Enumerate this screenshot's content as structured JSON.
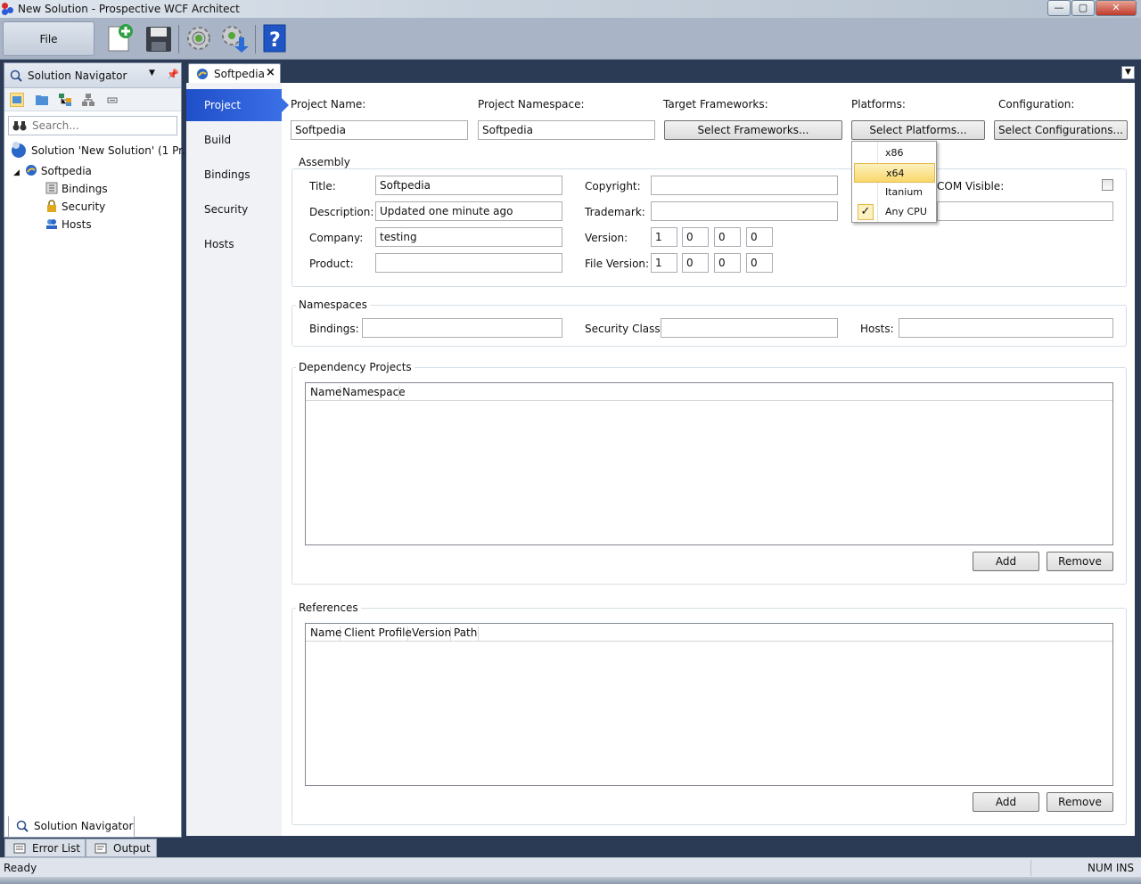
{
  "window": {
    "title": "New Solution - Prospective WCF Architect",
    "minimize": "—",
    "maximize": "▢",
    "close": "✕"
  },
  "toolbar": {
    "file_label": "File",
    "icons": [
      "new-document-icon",
      "save-icon",
      "gear-icon",
      "gear-download-icon",
      "help-icon"
    ]
  },
  "solution_navigator": {
    "title": "Solution Navigator",
    "search_placeholder": "Search...",
    "tree": [
      {
        "label": "Solution 'New Solution' (1 Pr...",
        "icon": "solution-icon"
      },
      {
        "label": "Softpedia",
        "icon": "project-globe-icon"
      },
      {
        "label": "Bindings",
        "icon": "bindings-icon"
      },
      {
        "label": "Security",
        "icon": "lock-icon"
      },
      {
        "label": "Hosts",
        "icon": "hosts-icon"
      }
    ],
    "bottom_tab": "Solution Navigator"
  },
  "document": {
    "tab_label": "Softpedia",
    "tab_close": "×"
  },
  "nav": [
    "Project",
    "Build",
    "Bindings",
    "Security",
    "Hosts"
  ],
  "project": {
    "name_label": "Project Name:",
    "name_value": "Softpedia",
    "namespace_label": "Project Namespace:",
    "namespace_value": "Softpedia",
    "frameworks_label": "Target Frameworks:",
    "frameworks_button": "Select Frameworks...",
    "platforms_label": "Platforms:",
    "platforms_button": "Select Platforms...",
    "configuration_label": "Configuration:",
    "configuration_button": "Select Configurations..."
  },
  "platforms_menu": [
    {
      "label": "x86",
      "checked": false
    },
    {
      "label": "x64",
      "checked": false
    },
    {
      "label": "Itanium",
      "checked": false
    },
    {
      "label": "Any CPU",
      "checked": true
    }
  ],
  "assembly": {
    "group_title": "Assembly",
    "title_label": "Title:",
    "title_value": "Softpedia",
    "description_label": "Description:",
    "description_value": "Updated one minute ago",
    "company_label": "Company:",
    "company_value": "testing",
    "product_label": "Product:",
    "product_value": "",
    "copyright_label": "Copyright:",
    "copyright_value": "",
    "trademark_label": "Trademark:",
    "trademark_value": "",
    "version_label": "Version:",
    "version": [
      "1",
      "0",
      "0",
      "0"
    ],
    "file_version_label": "File Version:",
    "file_version": [
      "1",
      "0",
      "0",
      "0"
    ],
    "com_visible_label": "COM Visible:",
    "com_visible": false
  },
  "namespaces": {
    "group_title": "Namespaces",
    "bindings_label": "Bindings:",
    "security_class_label": "Security Class:",
    "hosts_label": "Hosts:"
  },
  "dependency_projects": {
    "group_title": "Dependency Projects",
    "columns": [
      "Name",
      "Namespace"
    ],
    "add_button": "Add",
    "remove_button": "Remove"
  },
  "references": {
    "group_title": "References",
    "columns": [
      "Name",
      "Client Profile",
      "Version",
      "Path"
    ],
    "add_button": "Add",
    "remove_button": "Remove"
  },
  "bottom_tabs": [
    "Error List",
    "Output"
  ],
  "status": {
    "left": "Ready",
    "right": "NUM INS"
  }
}
